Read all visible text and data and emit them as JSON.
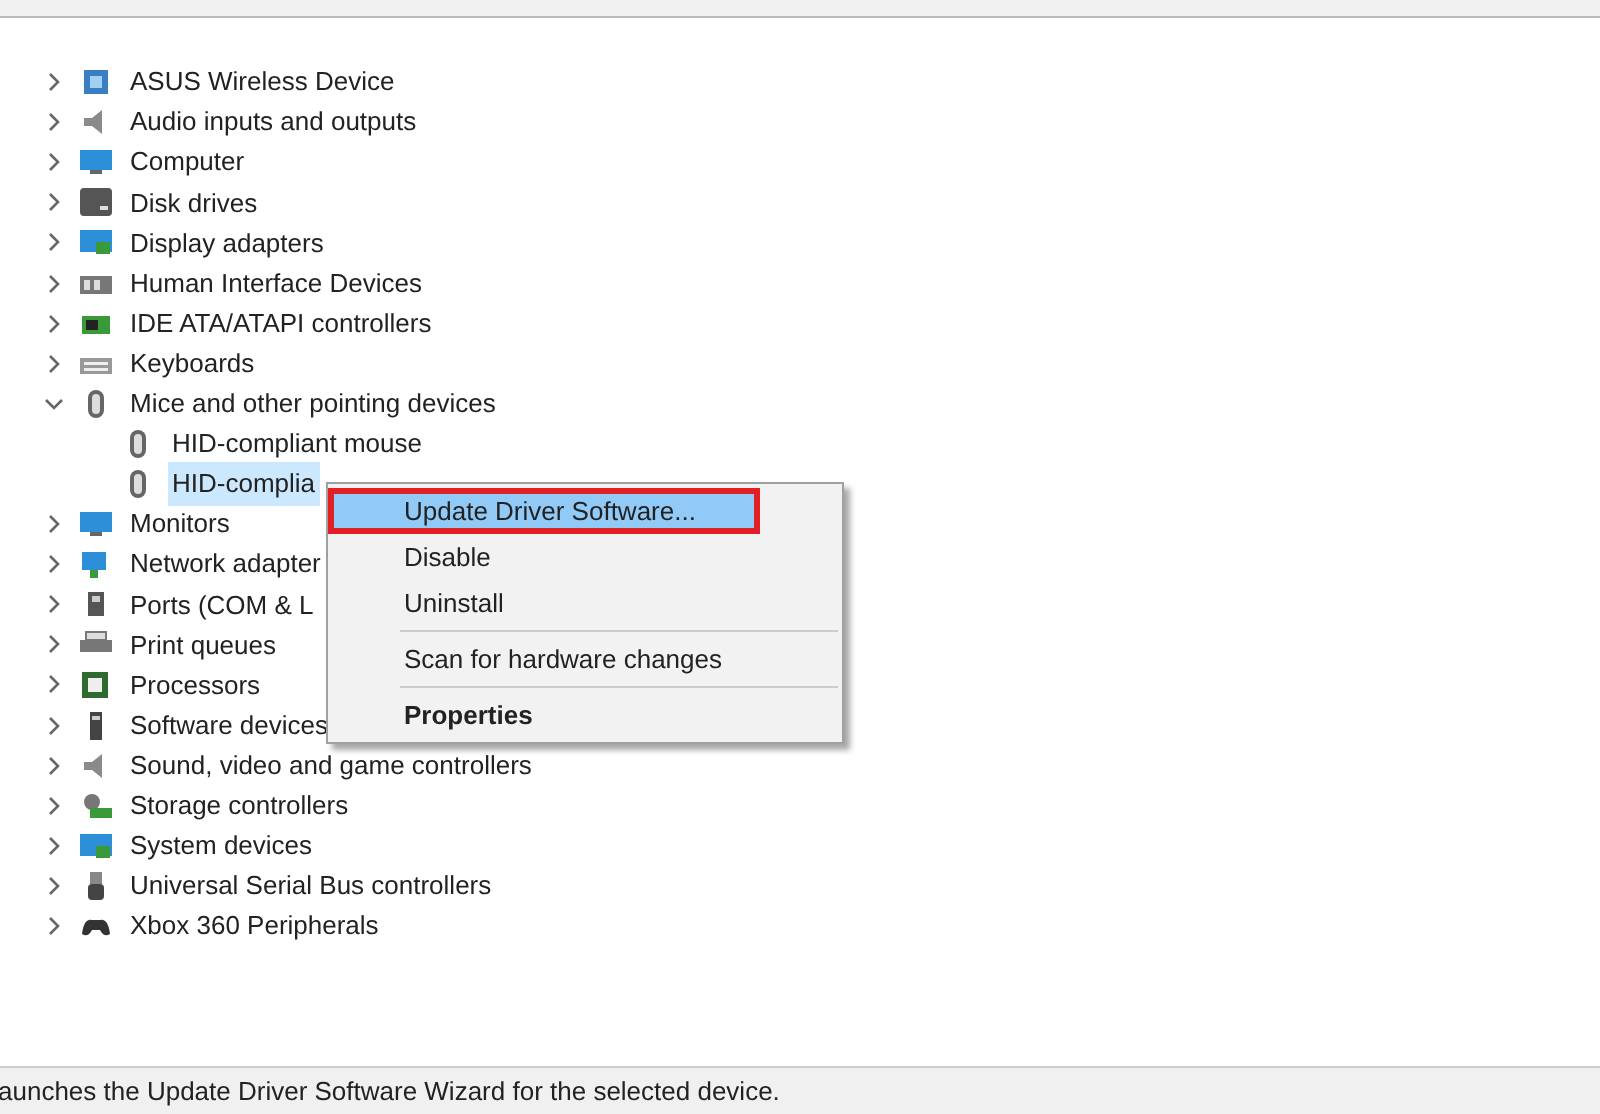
{
  "tree": [
    {
      "label": "ASUS Wireless Device",
      "kind": "radio",
      "expanded": false
    },
    {
      "label": "Audio inputs and outputs",
      "kind": "speaker",
      "expanded": false
    },
    {
      "label": "Computer",
      "kind": "monitor",
      "expanded": false
    },
    {
      "label": "Disk drives",
      "kind": "disk",
      "expanded": false
    },
    {
      "label": "Display adapters",
      "kind": "display",
      "expanded": false
    },
    {
      "label": "Human Interface Devices",
      "kind": "hid",
      "expanded": false
    },
    {
      "label": "IDE ATA/ATAPI controllers",
      "kind": "chip",
      "expanded": false
    },
    {
      "label": "Keyboards",
      "kind": "keyboard",
      "expanded": false
    },
    {
      "label": "Mice and other pointing devices",
      "kind": "mouse",
      "expanded": true,
      "children": [
        {
          "label": "HID-compliant mouse",
          "kind": "mouse",
          "selected": false
        },
        {
          "label": "HID-complia",
          "kind": "mouse",
          "selected": true
        }
      ]
    },
    {
      "label": "Monitors",
      "kind": "monitor",
      "expanded": false
    },
    {
      "label": "Network adapter",
      "kind": "network",
      "expanded": false
    },
    {
      "label": "Ports (COM & L",
      "kind": "port",
      "expanded": false
    },
    {
      "label": "Print queues",
      "kind": "printer",
      "expanded": false
    },
    {
      "label": "Processors",
      "kind": "cpu",
      "expanded": false
    },
    {
      "label": "Software devices",
      "kind": "software",
      "expanded": false
    },
    {
      "label": "Sound, video and game controllers",
      "kind": "speaker",
      "expanded": false
    },
    {
      "label": "Storage controllers",
      "kind": "storage",
      "expanded": false
    },
    {
      "label": "System devices",
      "kind": "display",
      "expanded": false
    },
    {
      "label": "Universal Serial Bus controllers",
      "kind": "usb",
      "expanded": false
    },
    {
      "label": "Xbox 360 Peripherals",
      "kind": "gamepad",
      "expanded": false
    }
  ],
  "context_menu": [
    {
      "kind": "item",
      "label": "Update Driver Software...",
      "selected": true,
      "default": false
    },
    {
      "kind": "item",
      "label": "Disable",
      "selected": false,
      "default": false
    },
    {
      "kind": "item",
      "label": "Uninstall",
      "selected": false,
      "default": false
    },
    {
      "kind": "separator"
    },
    {
      "kind": "item",
      "label": "Scan for hardware changes",
      "selected": false,
      "default": false
    },
    {
      "kind": "separator"
    },
    {
      "kind": "item",
      "label": "Properties",
      "selected": false,
      "default": true
    }
  ],
  "status_bar": "aunches the Update Driver Software Wizard for the selected device."
}
